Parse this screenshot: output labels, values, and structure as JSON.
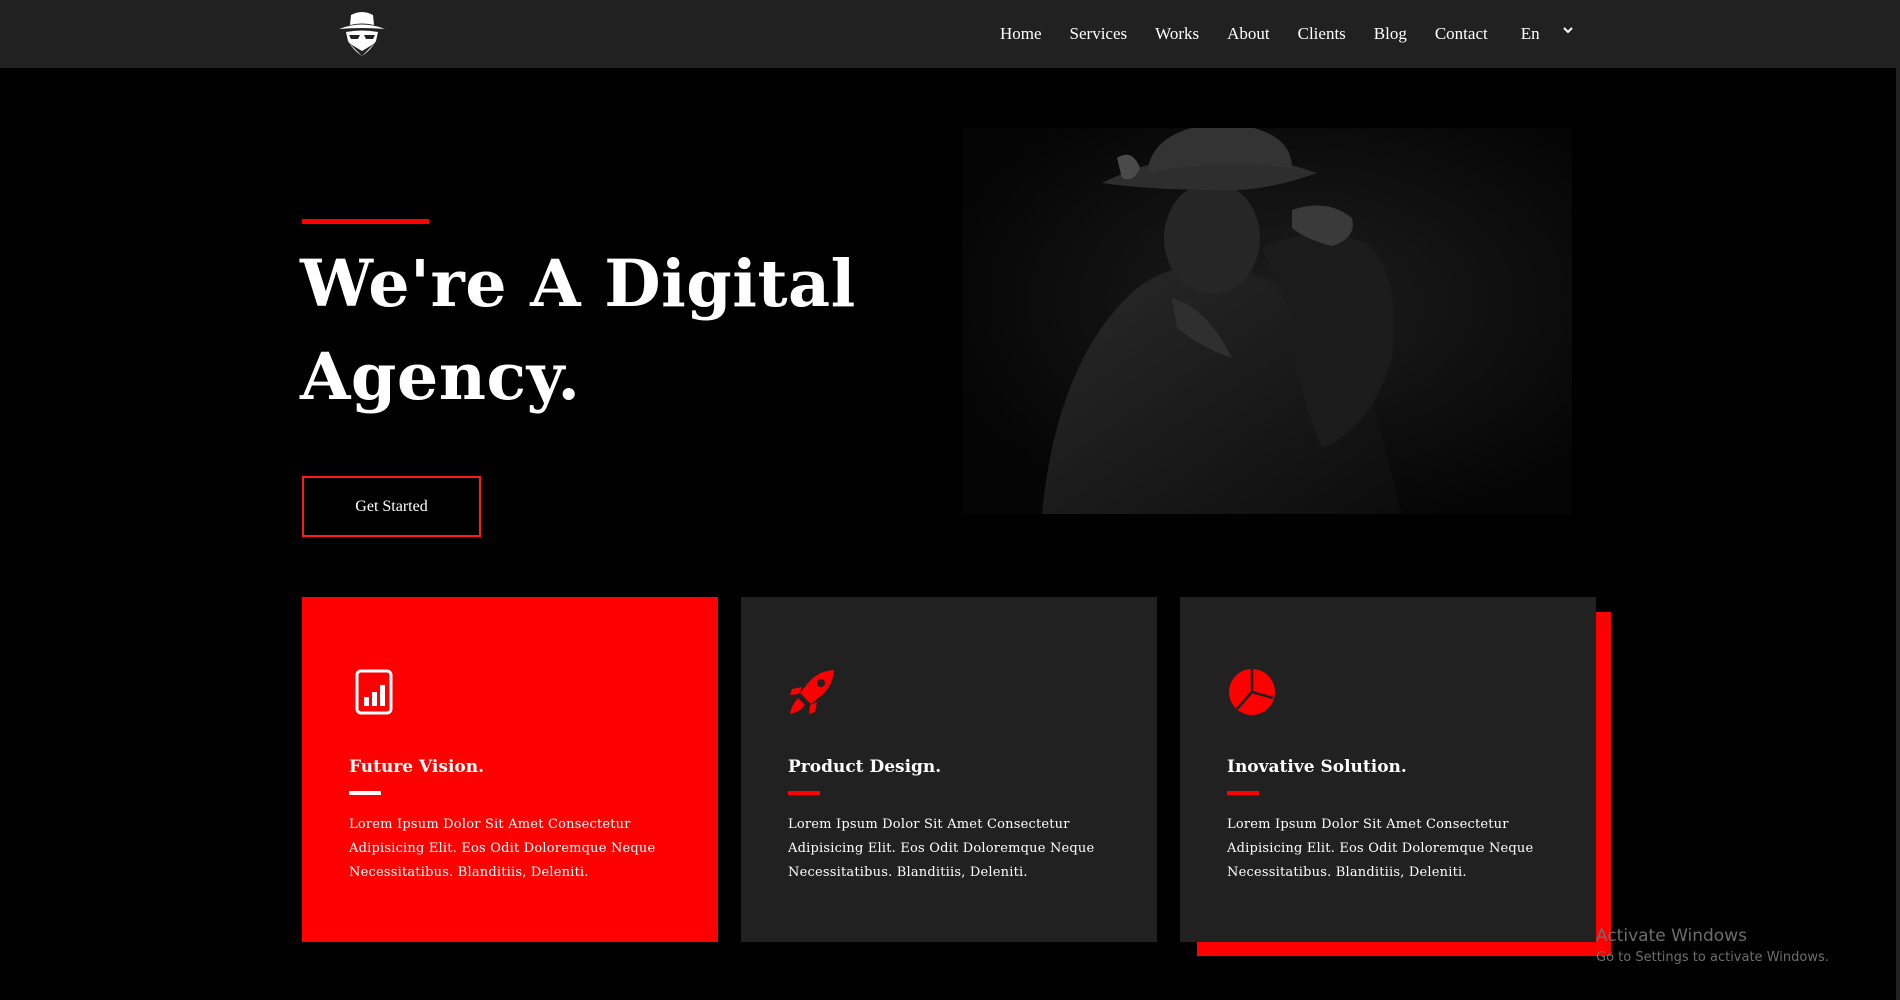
{
  "nav": {
    "logo_icon": "spy-hat-icon",
    "items": [
      {
        "label": "Home"
      },
      {
        "label": "Services"
      },
      {
        "label": "Works"
      },
      {
        "label": "About"
      },
      {
        "label": "Clients"
      },
      {
        "label": "Blog"
      },
      {
        "label": "Contact"
      }
    ],
    "language": {
      "label": "En",
      "icon": "chevron-down-icon"
    }
  },
  "hero": {
    "title_line1": "We're A Digital",
    "title_line2": "Agency.",
    "cta_label": "Get Started",
    "image_description_icon": "man-in-hat-photo"
  },
  "features": [
    {
      "title": "Future Vision.",
      "text": "Lorem Ipsum Dolor Sit Amet Consectetur Adipisicing Elit. Eos Odit Doloremque Neque Necessitatibus. Blanditiis, Deleniti.",
      "icon": "bar-chart-icon"
    },
    {
      "title": "Product Design.",
      "text": "Lorem Ipsum Dolor Sit Amet Consectetur Adipisicing Elit. Eos Odit Doloremque Neque Necessitatibus. Blanditiis, Deleniti.",
      "icon": "rocket-icon"
    },
    {
      "title": "Inovative Solution.",
      "text": "Lorem Ipsum Dolor Sit Amet Consectetur Adipisicing Elit. Eos Odit Doloremque Neque Necessitatibus. Blanditiis, Deleniti.",
      "icon": "pie-chart-icon"
    }
  ],
  "watermark": {
    "title": "Activate Windows",
    "subtitle": "Go to Settings to activate Windows."
  },
  "colors": {
    "accent": "#ff0000",
    "navbar": "#212121",
    "card": "#212121",
    "background": "#000000"
  }
}
